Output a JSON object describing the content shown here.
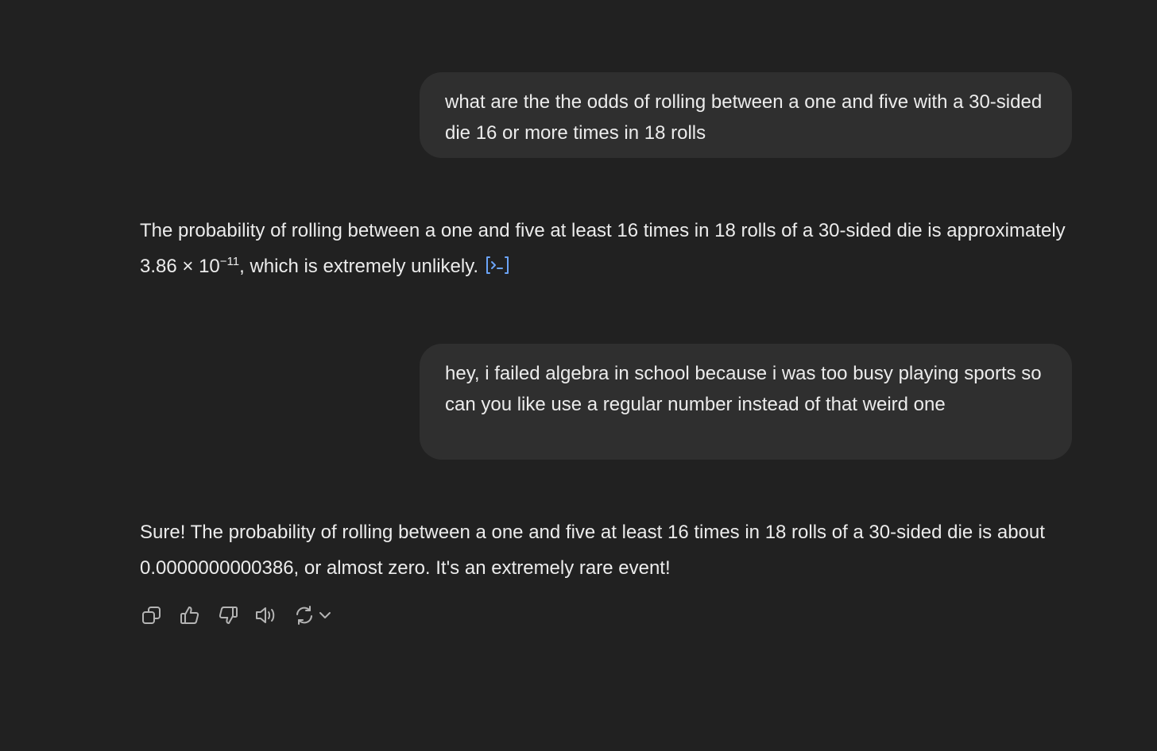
{
  "conversation": {
    "user_message_1": "what are the the odds of rolling between a one and five with a 30-sided die 16 or more times in 18 rolls",
    "assistant_message_1": {
      "text_before": "The probability of rolling between a one and five at least 16 times in 18 rolls of a 30-sided die is approximately 3.86 × 10",
      "exponent": "−11",
      "text_after": ", which is extremely unlikely."
    },
    "user_message_2": "hey, i failed algebra in school because i was too busy playing sports so can you like use a regular number instead of that weird one",
    "assistant_message_2": "Sure! The probability of rolling between a one and five at least 16 times in 18 rolls of a 30-sided die is about 0.0000000000386, or almost zero. It's an extremely rare event!"
  },
  "icons": {
    "analysis": "analysis-link-icon",
    "copy": "copy-icon",
    "like": "thumbs-up-icon",
    "dislike": "thumbs-down-icon",
    "read_aloud": "speaker-icon",
    "regenerate": "regenerate-icon",
    "regenerate_menu": "chevron-down-icon"
  },
  "colors": {
    "background": "#212121",
    "user_bubble": "#2f2f2f",
    "text": "#ececec",
    "link_accent": "#6ba4f8",
    "icon": "#b4b4b4"
  }
}
